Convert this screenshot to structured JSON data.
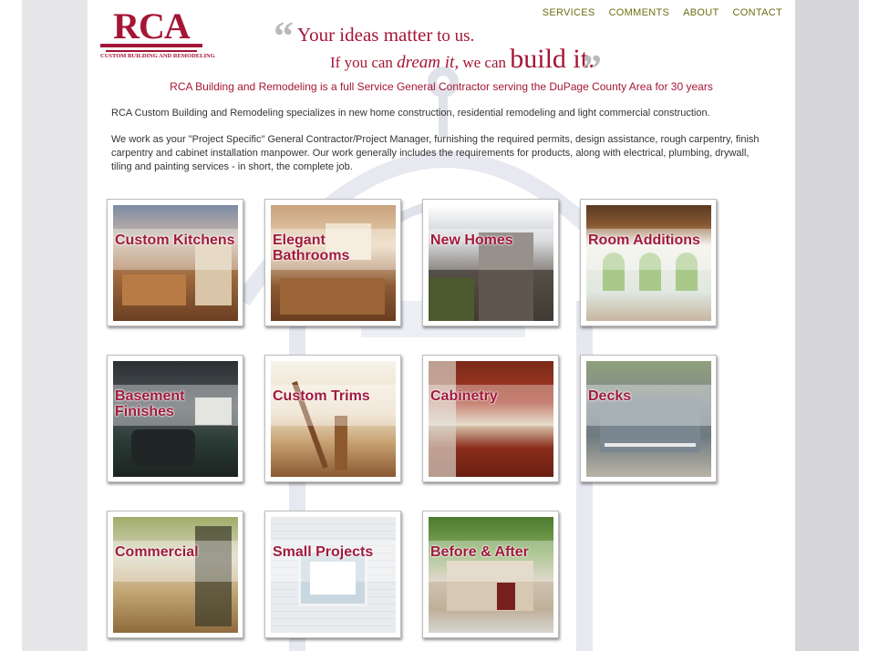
{
  "brand": {
    "name": "RCA",
    "subtitle": "CUSTOM BUILDING AND REMODELING"
  },
  "tagline": {
    "line1_a": "Your ideas matter",
    "line1_b": "to us.",
    "line2_a": "If you can",
    "line2_b": "dream it,",
    "line2_c": "we can",
    "line2_d": "build it."
  },
  "nav": [
    "SERVICES",
    "COMMENTS",
    "ABOUT",
    "CONTACT"
  ],
  "intro": "RCA Building and Remodeling is a full Service General Contractor serving the DuPage County Area for 30 years",
  "paragraph1": "RCA Custom Building and Remodeling specializes in new home construction, residential remodeling and light commercial construction.",
  "paragraph2": "We work as your \"Project Specific\" General Contractor/Project Manager, furnishing the required permits, design assistance, rough carpentry, finish carpentry and cabinet installation manpower. Our work generally includes the requirements for products, along with electrical, plumbing, drywall, tiling and painting services - in short, the complete job.",
  "tiles": [
    {
      "label": "Custom Kitchens"
    },
    {
      "label": "Elegant Bathrooms"
    },
    {
      "label": "New Homes"
    },
    {
      "label": "Room Additions"
    },
    {
      "label": "Basement Finishes"
    },
    {
      "label": "Custom Trims"
    },
    {
      "label": "Cabinetry"
    },
    {
      "label": "Decks"
    },
    {
      "label": "Commercial"
    },
    {
      "label": "Small Projects"
    },
    {
      "label": "Before & After"
    }
  ],
  "colors": {
    "brand": "#a51636",
    "nav": "#6e6e12",
    "text": "#333333"
  }
}
